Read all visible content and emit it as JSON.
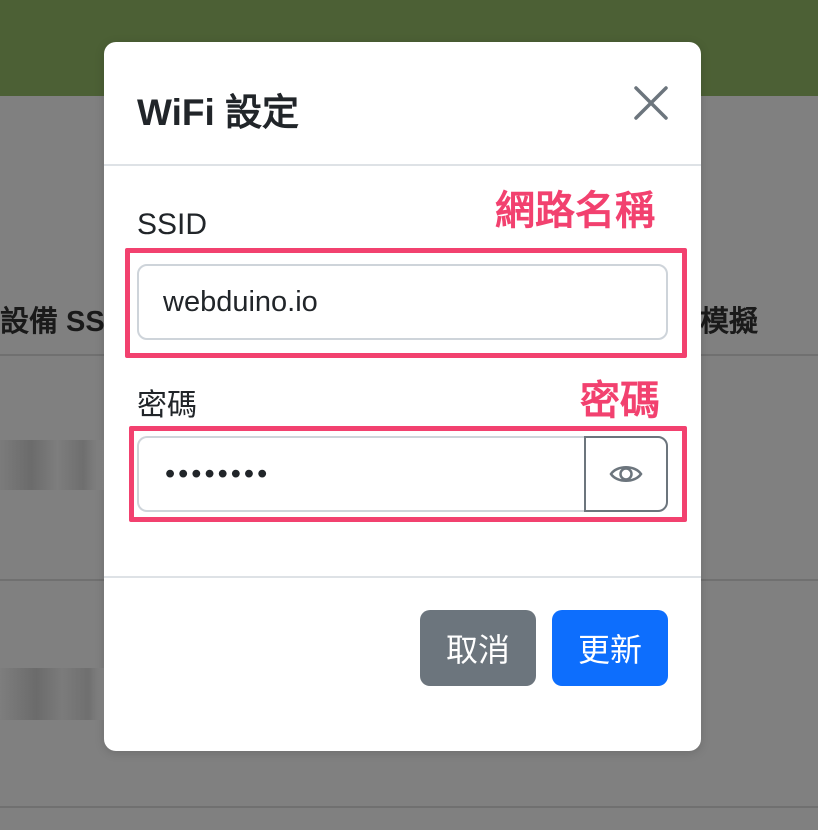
{
  "background": {
    "col_left": "設備 SSID",
    "col_right": "模擬"
  },
  "modal": {
    "title": "WiFi 設定",
    "close_icon": "close-icon",
    "ssid": {
      "label": "SSID",
      "value": "webduino.io",
      "annotation": "網路名稱"
    },
    "password": {
      "label": "密碼",
      "value": "••••••••",
      "annotation": "密碼",
      "toggle_icon": "eye-icon"
    },
    "buttons": {
      "cancel": "取消",
      "update": "更新"
    }
  },
  "colors": {
    "header_green": "#4c6035",
    "annotation_pink": "#f2416f",
    "primary": "#0d6efd",
    "secondary": "#6c757d"
  }
}
